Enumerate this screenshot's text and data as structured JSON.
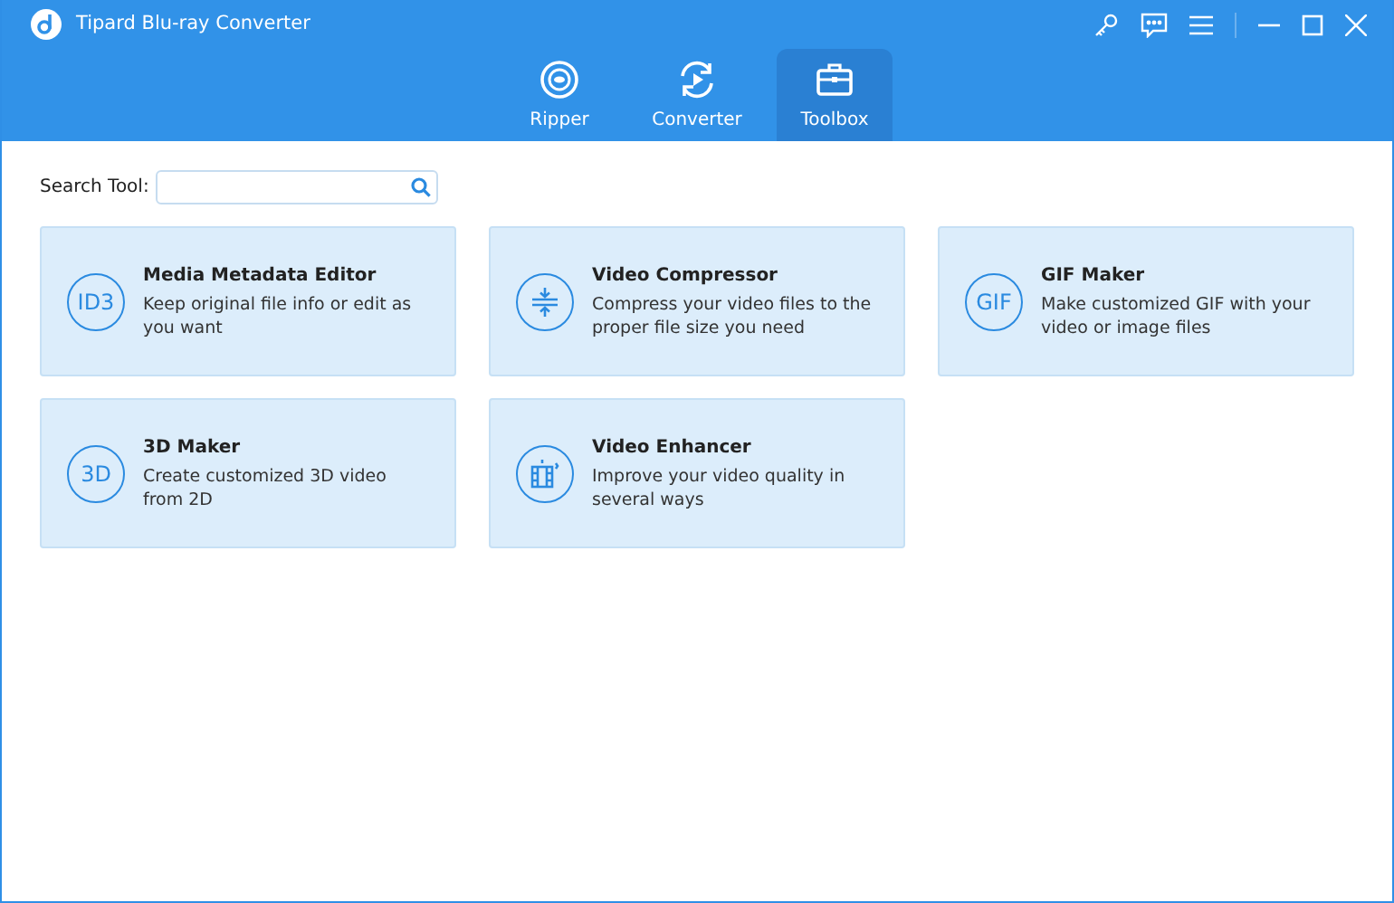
{
  "window": {
    "title": "Tipard Blu-ray Converter"
  },
  "tabs": [
    {
      "label": "Ripper",
      "kind": "ripper",
      "selected": false
    },
    {
      "label": "Converter",
      "kind": "converter",
      "selected": false
    },
    {
      "label": "Toolbox",
      "kind": "toolbox",
      "selected": true
    }
  ],
  "search": {
    "label": "Search Tool:"
  },
  "tools": [
    {
      "title": "Media Metadata Editor",
      "description": "Keep original file info or edit as you want",
      "kind": "text",
      "icon_text": "ID3"
    },
    {
      "title": "Video Compressor",
      "description": "Compress your video files to the proper file size you need",
      "kind": "compress"
    },
    {
      "title": "GIF Maker",
      "description": "Make customized GIF with your video or image files",
      "kind": "text",
      "icon_text": "GIF"
    },
    {
      "title": "3D Maker",
      "description": "Create customized 3D video from 2D",
      "kind": "text",
      "icon_text": "3D"
    },
    {
      "title": "Video Enhancer",
      "description": "Improve your video quality in several ways",
      "kind": "enhance"
    }
  ]
}
